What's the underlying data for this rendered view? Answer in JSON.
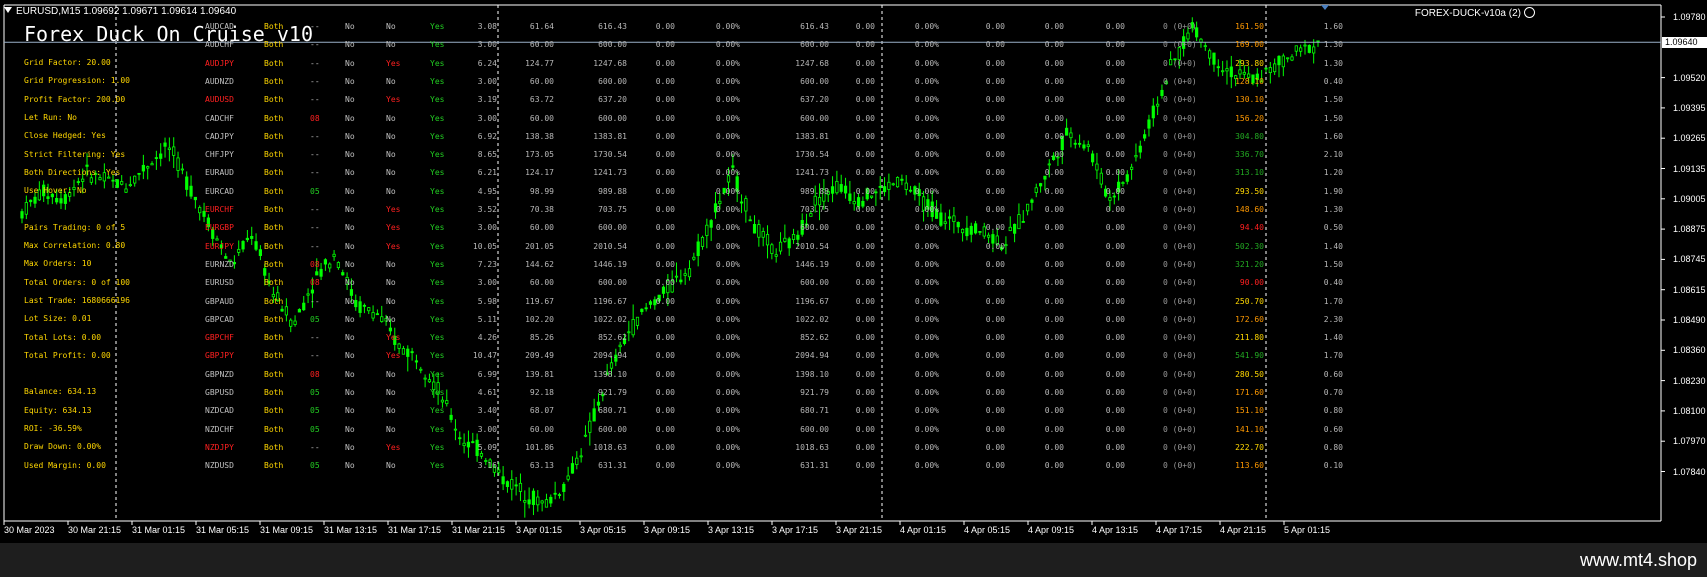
{
  "window": {
    "symbol_bar": "EURUSD,M15  1.09692 1.09671 1.09614 1.09640",
    "ea_label": "FOREX-DUCK-v10a (2)",
    "footer": "www.mt4.shop"
  },
  "panel": {
    "title": "Forex Duck On Cruise v10",
    "settings": [
      "Grid Factor: 20.00",
      "Grid Progression: 1.00",
      "Profit Factor: 200.00",
      "Let Run: No",
      "Close Hedged: Yes",
      "Strict Filtering: Yes",
      "Both Directions: Yes",
      "Use Hover: No",
      "",
      "Pairs Trading: 0 of 5",
      "Max Correlation: 0.80",
      "Max Orders: 10",
      "Total Orders: 0 of 100",
      "Last Trade: 1680666196",
      "Lot Size: 0.01",
      "Total Lots: 0.00",
      "Total Profit: 0.00",
      "",
      "Balance: 634.13",
      "Equity: 634.13",
      "ROI: -36.59%",
      "Draw Down: 0.00%",
      "Used Margin: 0.00"
    ]
  },
  "table": {
    "rows": [
      {
        "sym": "AUDCAD",
        "symc": "",
        "both": "Both",
        "c3": "--",
        "c3c": "",
        "c4": "No",
        "c5": "No",
        "c5c": "",
        "c6": "Yes",
        "n1": "3.08",
        "n2": "61.64",
        "n3": "616.43",
        "n4": "0.00",
        "n5": "0.00%",
        "n6": "616.43",
        "n7": "0.00",
        "n8": "0.00%",
        "n9": "0.00",
        "n10": "0.00",
        "n11": "0.00",
        "ord": "0 (0+0)",
        "pct": "161.50",
        "pctc": "orange",
        "ratio": "1.60"
      },
      {
        "sym": "AUDCHF",
        "symc": "",
        "both": "Both",
        "c3": "--",
        "c3c": "",
        "c4": "No",
        "c5": "No",
        "c5c": "",
        "c6": "Yes",
        "n1": "3.00",
        "n2": "60.00",
        "n3": "600.00",
        "n4": "0.00",
        "n5": "0.00%",
        "n6": "600.00",
        "n7": "0.00",
        "n8": "0.00%",
        "n9": "0.00",
        "n10": "0.00",
        "n11": "0.00",
        "ord": "0 (0+0)",
        "pct": "169.00",
        "pctc": "orange",
        "ratio": "1.30"
      },
      {
        "sym": "AUDJPY",
        "symc": "red",
        "both": "Both",
        "c3": "--",
        "c3c": "",
        "c4": "No",
        "c5": "Yes",
        "c5c": "red",
        "c6": "Yes",
        "n1": "6.24",
        "n2": "124.77",
        "n3": "1247.68",
        "n4": "0.00",
        "n5": "0.00%",
        "n6": "1247.68",
        "n7": "0.00",
        "n8": "0.00%",
        "n9": "0.00",
        "n10": "0.00",
        "n11": "0.00",
        "ord": "0 (0+0)",
        "pct": "293.80",
        "pctc": "yellow",
        "ratio": "1.30"
      },
      {
        "sym": "AUDNZD",
        "symc": "",
        "both": "Both",
        "c3": "--",
        "c3c": "",
        "c4": "No",
        "c5": "No",
        "c5c": "",
        "c6": "Yes",
        "n1": "3.00",
        "n2": "60.00",
        "n3": "600.00",
        "n4": "0.00",
        "n5": "0.00%",
        "n6": "600.00",
        "n7": "0.00",
        "n8": "0.00%",
        "n9": "0.00",
        "n10": "0.00",
        "n11": "0.00",
        "ord": "0 (0+0)",
        "pct": "128.10",
        "pctc": "orange",
        "ratio": "0.40"
      },
      {
        "sym": "AUDUSD",
        "symc": "red",
        "both": "Both",
        "c3": "--",
        "c3c": "",
        "c4": "No",
        "c5": "Yes",
        "c5c": "red",
        "c6": "Yes",
        "n1": "3.19",
        "n2": "63.72",
        "n3": "637.20",
        "n4": "0.00",
        "n5": "0.00%",
        "n6": "637.20",
        "n7": "0.00",
        "n8": "0.00%",
        "n9": "0.00",
        "n10": "0.00",
        "n11": "0.00",
        "ord": "0 (0+0)",
        "pct": "130.10",
        "pctc": "orange",
        "ratio": "1.50"
      },
      {
        "sym": "CADCHF",
        "symc": "",
        "both": "Both",
        "c3": "08",
        "c3c": "red",
        "c4": "No",
        "c5": "No",
        "c5c": "",
        "c6": "Yes",
        "n1": "3.00",
        "n2": "60.00",
        "n3": "600.00",
        "n4": "0.00",
        "n5": "0.00%",
        "n6": "600.00",
        "n7": "0.00",
        "n8": "0.00%",
        "n9": "0.00",
        "n10": "0.00",
        "n11": "0.00",
        "ord": "0 (0+0)",
        "pct": "156.20",
        "pctc": "orange",
        "ratio": "1.50"
      },
      {
        "sym": "CADJPY",
        "symc": "",
        "both": "Both",
        "c3": "--",
        "c3c": "",
        "c4": "No",
        "c5": "No",
        "c5c": "",
        "c6": "Yes",
        "n1": "6.92",
        "n2": "138.38",
        "n3": "1383.81",
        "n4": "0.00",
        "n5": "0.00%",
        "n6": "1383.81",
        "n7": "0.00",
        "n8": "0.00%",
        "n9": "0.00",
        "n10": "0.00",
        "n11": "0.00",
        "ord": "0 (0+0)",
        "pct": "304.80",
        "pctc": "green",
        "ratio": "1.60"
      },
      {
        "sym": "CHFJPY",
        "symc": "",
        "both": "Both",
        "c3": "--",
        "c3c": "",
        "c4": "No",
        "c5": "No",
        "c5c": "",
        "c6": "Yes",
        "n1": "8.65",
        "n2": "173.05",
        "n3": "1730.54",
        "n4": "0.00",
        "n5": "0.00%",
        "n6": "1730.54",
        "n7": "0.00",
        "n8": "0.00%",
        "n9": "0.00",
        "n10": "0.00",
        "n11": "0.00",
        "ord": "0 (0+0)",
        "pct": "336.70",
        "pctc": "green",
        "ratio": "2.10"
      },
      {
        "sym": "EURAUD",
        "symc": "",
        "both": "Both",
        "c3": "--",
        "c3c": "",
        "c4": "No",
        "c5": "No",
        "c5c": "",
        "c6": "Yes",
        "n1": "6.21",
        "n2": "124.17",
        "n3": "1241.73",
        "n4": "0.00",
        "n5": "0.00%",
        "n6": "1241.73",
        "n7": "0.00",
        "n8": "0.00%",
        "n9": "0.00",
        "n10": "0.00",
        "n11": "0.00",
        "ord": "0 (0+0)",
        "pct": "313.10",
        "pctc": "green",
        "ratio": "1.20"
      },
      {
        "sym": "EURCAD",
        "symc": "",
        "both": "Both",
        "c3": "05",
        "c3c": "green",
        "c4": "No",
        "c5": "No",
        "c5c": "",
        "c6": "Yes",
        "n1": "4.95",
        "n2": "98.99",
        "n3": "989.88",
        "n4": "0.00",
        "n5": "0.00%",
        "n6": "989.88",
        "n7": "0.00",
        "n8": "0.00%",
        "n9": "0.00",
        "n10": "0.00",
        "n11": "0.00",
        "ord": "0 (0+0)",
        "pct": "293.50",
        "pctc": "yellow",
        "ratio": "1.90"
      },
      {
        "sym": "EURCHF",
        "symc": "red",
        "both": "Both",
        "c3": "--",
        "c3c": "",
        "c4": "No",
        "c5": "Yes",
        "c5c": "red",
        "c6": "Yes",
        "n1": "3.52",
        "n2": "70.38",
        "n3": "703.75",
        "n4": "0.00",
        "n5": "0.00%",
        "n6": "703.75",
        "n7": "0.00",
        "n8": "0.00%",
        "n9": "0.00",
        "n10": "0.00",
        "n11": "0.00",
        "ord": "0 (0+0)",
        "pct": "148.60",
        "pctc": "orange",
        "ratio": "1.30"
      },
      {
        "sym": "EURGBP",
        "symc": "red",
        "both": "Both",
        "c3": "--",
        "c3c": "",
        "c4": "No",
        "c5": "Yes",
        "c5c": "red",
        "c6": "Yes",
        "n1": "3.00",
        "n2": "60.00",
        "n3": "600.00",
        "n4": "0.00",
        "n5": "0.00%",
        "n6": "600.00",
        "n7": "0.00",
        "n8": "0.00%",
        "n9": "0.00",
        "n10": "0.00",
        "n11": "0.00",
        "ord": "0 (0+0)",
        "pct": "94.40",
        "pctc": "red",
        "ratio": "0.50"
      },
      {
        "sym": "EURJPY",
        "symc": "red",
        "both": "Both",
        "c3": "--",
        "c3c": "",
        "c4": "No",
        "c5": "Yes",
        "c5c": "red",
        "c6": "Yes",
        "n1": "10.05",
        "n2": "201.05",
        "n3": "2010.54",
        "n4": "0.00",
        "n5": "0.00%",
        "n6": "2010.54",
        "n7": "0.00",
        "n8": "0.00%",
        "n9": "0.00",
        "n10": "0.00",
        "n11": "0.00",
        "ord": "0 (0+0)",
        "pct": "502.30",
        "pctc": "green",
        "ratio": "1.40"
      },
      {
        "sym": "EURNZD",
        "symc": "",
        "both": "Both",
        "c3": "08",
        "c3c": "red",
        "c4": "No",
        "c5": "No",
        "c5c": "",
        "c6": "Yes",
        "n1": "7.23",
        "n2": "144.62",
        "n3": "1446.19",
        "n4": "0.00",
        "n5": "0.00%",
        "n6": "1446.19",
        "n7": "0.00",
        "n8": "0.00%",
        "n9": "0.00",
        "n10": "0.00",
        "n11": "0.00",
        "ord": "0 (0+0)",
        "pct": "321.20",
        "pctc": "green",
        "ratio": "1.50"
      },
      {
        "sym": "EURUSD",
        "symc": "",
        "both": "Both",
        "c3": "08",
        "c3c": "red",
        "c4": "No",
        "c5": "No",
        "c5c": "",
        "c6": "Yes",
        "n1": "3.00",
        "n2": "60.00",
        "n3": "600.00",
        "n4": "0.00",
        "n5": "0.00%",
        "n6": "600.00",
        "n7": "0.00",
        "n8": "0.00%",
        "n9": "0.00",
        "n10": "0.00",
        "n11": "0.00",
        "ord": "0 (0+0)",
        "pct": "90.00",
        "pctc": "red",
        "ratio": "0.40"
      },
      {
        "sym": "GBPAUD",
        "symc": "",
        "both": "Both",
        "c3": "--",
        "c3c": "",
        "c4": "No",
        "c5": "No",
        "c5c": "",
        "c6": "Yes",
        "n1": "5.98",
        "n2": "119.67",
        "n3": "1196.67",
        "n4": "0.00",
        "n5": "0.00%",
        "n6": "1196.67",
        "n7": "0.00",
        "n8": "0.00%",
        "n9": "0.00",
        "n10": "0.00",
        "n11": "0.00",
        "ord": "0 (0+0)",
        "pct": "250.70",
        "pctc": "yellow",
        "ratio": "1.70"
      },
      {
        "sym": "GBPCAD",
        "symc": "",
        "both": "Both",
        "c3": "05",
        "c3c": "green",
        "c4": "No",
        "c5": "No",
        "c5c": "",
        "c6": "Yes",
        "n1": "5.11",
        "n2": "102.20",
        "n3": "1022.02",
        "n4": "0.00",
        "n5": "0.00%",
        "n6": "1022.02",
        "n7": "0.00",
        "n8": "0.00%",
        "n9": "0.00",
        "n10": "0.00",
        "n11": "0.00",
        "ord": "0 (0+0)",
        "pct": "172.60",
        "pctc": "orange",
        "ratio": "2.30"
      },
      {
        "sym": "GBPCHF",
        "symc": "red",
        "both": "Both",
        "c3": "--",
        "c3c": "",
        "c4": "No",
        "c5": "Yes",
        "c5c": "red",
        "c6": "Yes",
        "n1": "4.26",
        "n2": "85.26",
        "n3": "852.62",
        "n4": "0.00",
        "n5": "0.00%",
        "n6": "852.62",
        "n7": "0.00",
        "n8": "0.00%",
        "n9": "0.00",
        "n10": "0.00",
        "n11": "0.00",
        "ord": "0 (0+0)",
        "pct": "211.80",
        "pctc": "yellow",
        "ratio": "1.40"
      },
      {
        "sym": "GBPJPY",
        "symc": "red",
        "both": "Both",
        "c3": "--",
        "c3c": "",
        "c4": "No",
        "c5": "Yes",
        "c5c": "red",
        "c6": "Yes",
        "n1": "10.47",
        "n2": "209.49",
        "n3": "2094.94",
        "n4": "0.00",
        "n5": "0.00%",
        "n6": "2094.94",
        "n7": "0.00",
        "n8": "0.00%",
        "n9": "0.00",
        "n10": "0.00",
        "n11": "0.00",
        "ord": "0 (0+0)",
        "pct": "541.90",
        "pctc": "green",
        "ratio": "1.70"
      },
      {
        "sym": "GBPNZD",
        "symc": "",
        "both": "Both",
        "c3": "08",
        "c3c": "red",
        "c4": "No",
        "c5": "No",
        "c5c": "",
        "c6": "Yes",
        "n1": "6.99",
        "n2": "139.81",
        "n3": "1398.10",
        "n4": "0.00",
        "n5": "0.00%",
        "n6": "1398.10",
        "n7": "0.00",
        "n8": "0.00%",
        "n9": "0.00",
        "n10": "0.00",
        "n11": "0.00",
        "ord": "0 (0+0)",
        "pct": "280.50",
        "pctc": "yellow",
        "ratio": "0.60"
      },
      {
        "sym": "GBPUSD",
        "symc": "",
        "both": "Both",
        "c3": "05",
        "c3c": "green",
        "c4": "No",
        "c5": "No",
        "c5c": "",
        "c6": "Yes",
        "n1": "4.61",
        "n2": "92.18",
        "n3": "921.79",
        "n4": "0.00",
        "n5": "0.00%",
        "n6": "921.79",
        "n7": "0.00",
        "n8": "0.00%",
        "n9": "0.00",
        "n10": "0.00",
        "n11": "0.00",
        "ord": "0 (0+0)",
        "pct": "171.60",
        "pctc": "orange",
        "ratio": "0.70"
      },
      {
        "sym": "NZDCAD",
        "symc": "",
        "both": "Both",
        "c3": "05",
        "c3c": "green",
        "c4": "No",
        "c5": "No",
        "c5c": "",
        "c6": "Yes",
        "n1": "3.40",
        "n2": "68.07",
        "n3": "680.71",
        "n4": "0.00",
        "n5": "0.00%",
        "n6": "680.71",
        "n7": "0.00",
        "n8": "0.00%",
        "n9": "0.00",
        "n10": "0.00",
        "n11": "0.00",
        "ord": "0 (0+0)",
        "pct": "151.10",
        "pctc": "orange",
        "ratio": "0.80"
      },
      {
        "sym": "NZDCHF",
        "symc": "",
        "both": "Both",
        "c3": "05",
        "c3c": "green",
        "c4": "No",
        "c5": "No",
        "c5c": "",
        "c6": "Yes",
        "n1": "3.00",
        "n2": "60.00",
        "n3": "600.00",
        "n4": "0.00",
        "n5": "0.00%",
        "n6": "600.00",
        "n7": "0.00",
        "n8": "0.00%",
        "n9": "0.00",
        "n10": "0.00",
        "n11": "0.00",
        "ord": "0 (0+0)",
        "pct": "141.10",
        "pctc": "orange",
        "ratio": "0.60"
      },
      {
        "sym": "NZDJPY",
        "symc": "red",
        "both": "Both",
        "c3": "--",
        "c3c": "",
        "c4": "No",
        "c5": "Yes",
        "c5c": "red",
        "c6": "Yes",
        "n1": "5.09",
        "n2": "101.86",
        "n3": "1018.63",
        "n4": "0.00",
        "n5": "0.00%",
        "n6": "1018.63",
        "n7": "0.00",
        "n8": "0.00%",
        "n9": "0.00",
        "n10": "0.00",
        "n11": "0.00",
        "ord": "0 (0+0)",
        "pct": "222.70",
        "pctc": "yellow",
        "ratio": "0.80"
      },
      {
        "sym": "NZDUSD",
        "symc": "",
        "both": "Both",
        "c3": "05",
        "c3c": "green",
        "c4": "No",
        "c5": "No",
        "c5c": "",
        "c6": "Yes",
        "n1": "3.16",
        "n2": "63.13",
        "n3": "631.31",
        "n4": "0.00",
        "n5": "0.00%",
        "n6": "631.31",
        "n7": "0.00",
        "n8": "0.00%",
        "n9": "0.00",
        "n10": "0.00",
        "n11": "0.00",
        "ord": "0 (0+0)",
        "pct": "113.60",
        "pctc": "orange",
        "ratio": "0.10"
      }
    ]
  },
  "price_axis": {
    "labels": [
      "1.09780",
      "1.09640",
      "1.09520",
      "1.09395",
      "1.09265",
      "1.09135",
      "1.09005",
      "1.08875",
      "1.08745",
      "1.08615",
      "1.08490",
      "1.08360",
      "1.08230",
      "1.08100",
      "1.07970",
      "1.07840"
    ],
    "current": "1.09640"
  },
  "time_axis": {
    "labels": [
      "30 Mar 2023",
      "30 Mar 21:15",
      "31 Mar 01:15",
      "31 Mar 05:15",
      "31 Mar 09:15",
      "31 Mar 13:15",
      "31 Mar 17:15",
      "31 Mar 21:15",
      "3 Apr 01:15",
      "3 Apr 05:15",
      "3 Apr 09:15",
      "3 Apr 13:15",
      "3 Apr 17:15",
      "3 Apr 21:15",
      "4 Apr 01:15",
      "4 Apr 05:15",
      "4 Apr 09:15",
      "4 Apr 13:15",
      "4 Apr 17:15",
      "4 Apr 21:15",
      "5 Apr 01:15"
    ]
  },
  "chart_data": {
    "type": "line",
    "title": "",
    "series": [
      {
        "values": [
          1.09,
          1.0908,
          1.0905,
          1.0915,
          1.0912,
          1.091,
          1.0918,
          1.0925,
          1.091,
          1.0895,
          1.088,
          1.0892,
          1.087,
          1.0858,
          1.0875,
          1.0885,
          1.0865,
          1.0862,
          1.085,
          1.0845,
          1.0832,
          1.0815,
          1.081,
          1.08,
          1.0795,
          1.079,
          1.0798,
          1.0815,
          1.0838,
          1.0855,
          1.0865,
          1.0872,
          1.088,
          1.0898,
          1.0915,
          1.0895,
          1.0885,
          1.089,
          1.0905,
          1.091,
          1.0905,
          1.0908,
          1.0912,
          1.0905,
          1.0898,
          1.0895,
          1.0893,
          1.0888,
          1.09,
          1.0915,
          1.093,
          1.0925,
          1.0905,
          1.0915,
          1.0935,
          1.0955,
          1.097,
          1.0958,
          1.0952,
          1.095,
          1.0955,
          1.096,
          1.0964
        ]
      }
    ],
    "ylim": [
      1.0784,
      1.0978
    ],
    "grid": false
  }
}
